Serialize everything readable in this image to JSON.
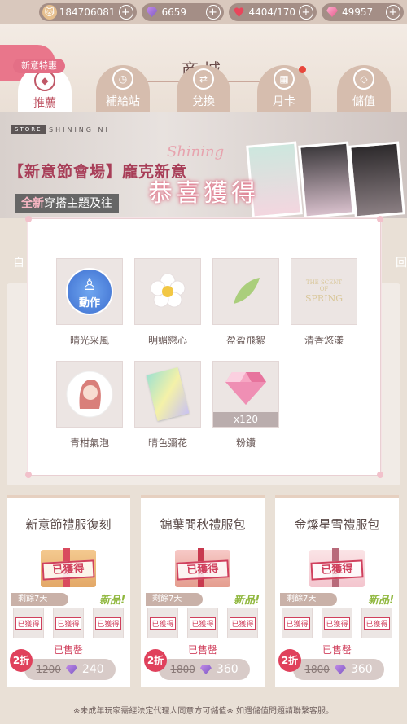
{
  "resources": {
    "gold": "184706081",
    "diamond": "6659",
    "stamina": "4404/170",
    "pink_diamond": "49957"
  },
  "header": {
    "title": "商城"
  },
  "tabs": [
    {
      "label": "推薦",
      "active": true
    },
    {
      "label": "補給站"
    },
    {
      "label": "兌換"
    },
    {
      "label": "月卡"
    },
    {
      "label": "儲值"
    }
  ],
  "new_tag": "新意特惠",
  "banner": {
    "store_label": "STORE",
    "store_tag": "SHINING NI",
    "shining": "Shining",
    "title": "【新意節會場】龐克新意",
    "subtitle_highlight": "全新",
    "subtitle": "穿搭主題及往"
  },
  "side_tabs": {
    "left": "自",
    "right": "回"
  },
  "modal": {
    "congrats": "恭喜獲得",
    "items": [
      {
        "name": "晴光采風",
        "icon": "action-badge-icon",
        "badge": "動作"
      },
      {
        "name": "明媚戀心",
        "icon": "flower-icon"
      },
      {
        "name": "盈盈飛絮",
        "icon": "leaf-icon"
      },
      {
        "name": "清香悠漾",
        "icon": "scent-card-icon",
        "text_lines": [
          "THE SCENT",
          "OF",
          "SPRING"
        ]
      },
      {
        "name": "青柑氣泡",
        "icon": "portrait-icon"
      },
      {
        "name": "晴色彌花",
        "icon": "card-icon"
      },
      {
        "name": "粉鑽",
        "icon": "pink-diamond-icon",
        "qty": "x120"
      }
    ]
  },
  "packs": [
    {
      "name": "新意節禮服復刻",
      "got": "已獲得",
      "remain": "剩餘7天",
      "new": "新品!",
      "minis": [
        "已獲得",
        "已獲得",
        "已獲得"
      ],
      "sold": "已售罄",
      "discount": "2折",
      "old_price": "1200",
      "price": "240"
    },
    {
      "name": "錦葉閒秋禮服包",
      "got": "已獲得",
      "remain": "剩餘7天",
      "new": "新品!",
      "minis": [
        "已獲得",
        "已獲得",
        "已獲得"
      ],
      "sold": "已售罄",
      "discount": "2折",
      "old_price": "1800",
      "price": "360"
    },
    {
      "name": "金燦星雪禮服包",
      "got": "已獲得",
      "remain": "剩餘7天",
      "new": "新品!",
      "minis": [
        "已獲得",
        "已獲得",
        "已獲得"
      ],
      "sold": "已售罄",
      "discount": "2折",
      "old_price": "1800",
      "price": "360"
    }
  ],
  "footer": "※未成年玩家需經法定代理人同意方可儲值※ 如遇儲值問題請聯繫客服。"
}
